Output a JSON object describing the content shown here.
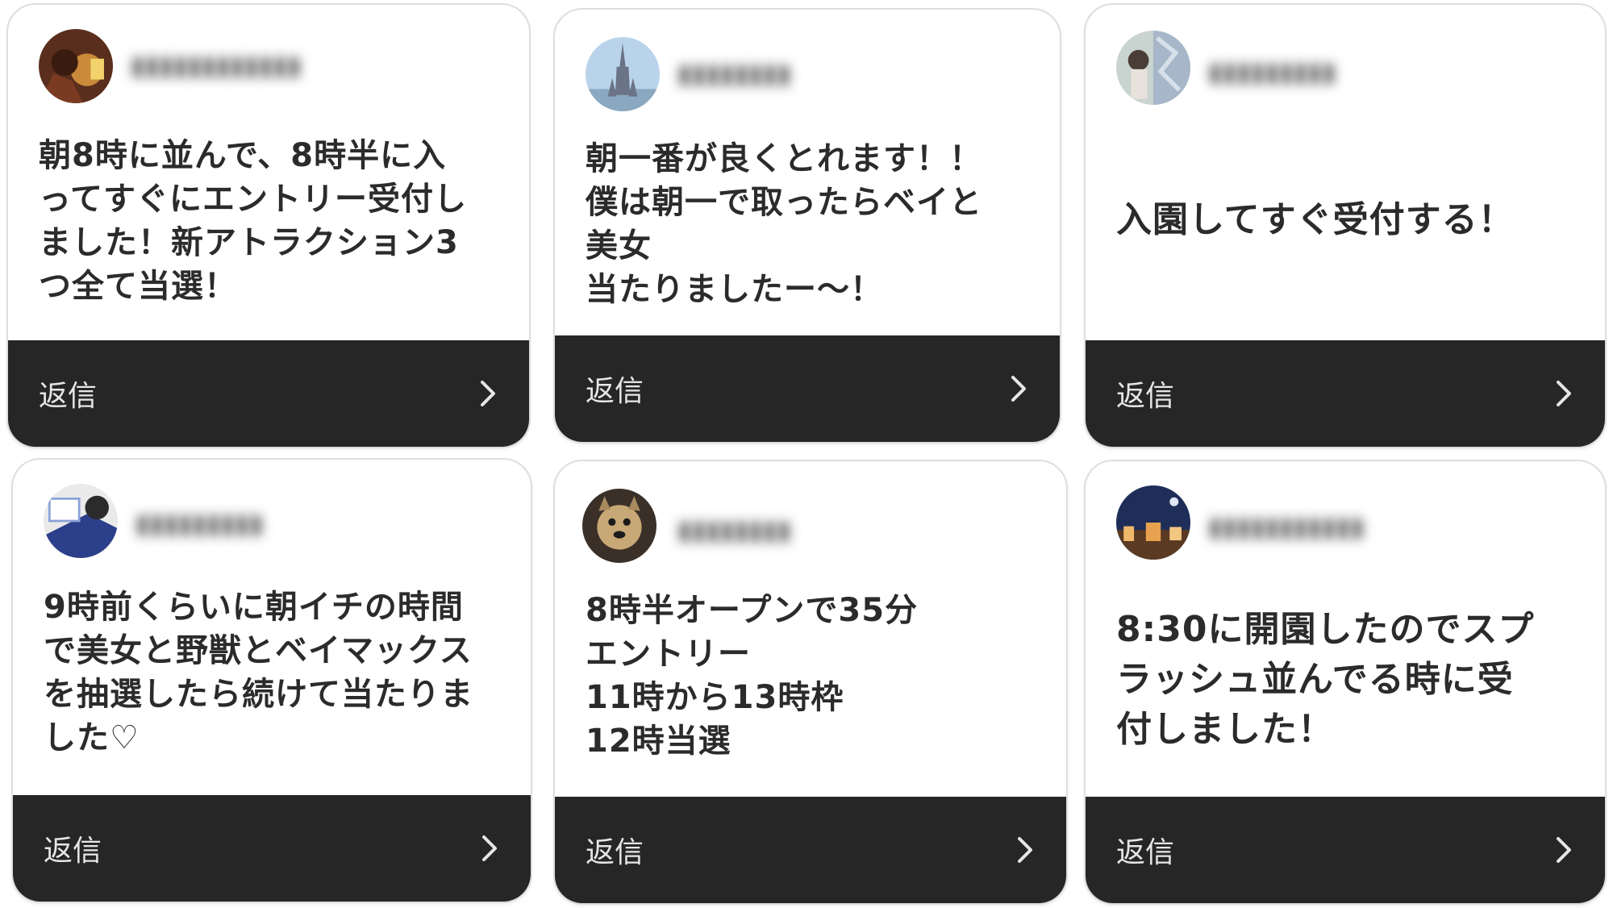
{
  "colors": {
    "card_background": "#ffffff",
    "reply_bar": "#262626",
    "reply_text": "#e6e6e6",
    "comment_text": "#2b2b2b"
  },
  "cards": [
    {
      "username": "▮▮▮▮▮▮▮▮▮▮▮▮",
      "comment": "朝8時に並んで、8時半に入\nってすぐにエントリー受付し\nました！新アトラクション3\nつ全て当選！",
      "reply_label": "返信",
      "avatar_icon": "user-avatar-icon",
      "reply_icon": "chevron-right-icon"
    },
    {
      "username": "▮▮▮▮▮▮▮▮",
      "comment": "朝一番が良くとれます！！\n僕は朝一で取ったらベイと\n美女\n当たりましたー〜！",
      "reply_label": "返信",
      "avatar_icon": "user-avatar-icon",
      "reply_icon": "chevron-right-icon"
    },
    {
      "username": "▮▮▮▮▮▮▮▮▮",
      "comment": "入園してすぐ受付する！",
      "reply_label": "返信",
      "avatar_icon": "user-avatar-icon",
      "reply_icon": "chevron-right-icon"
    },
    {
      "username": "▮▮▮▮▮▮▮▮▮",
      "comment": "9時前くらいに朝イチの時間\nで美女と野獣とベイマックス\nを抽選したら続けて当たりま\nした♡",
      "reply_label": "返信",
      "avatar_icon": "user-avatar-icon",
      "reply_icon": "chevron-right-icon"
    },
    {
      "username": "▮▮▮▮▮▮▮▮",
      "comment": "8時半オープンで35分\nエントリー\n11時から13時枠\n12時当選",
      "reply_label": "返信",
      "avatar_icon": "user-avatar-icon",
      "reply_icon": "chevron-right-icon"
    },
    {
      "username": "▮▮▮▮▮▮▮▮▮▮▮",
      "comment": "8:30に開園したのでスプ\nラッシュ並んでる時に受\n付しました！",
      "reply_label": "返信",
      "avatar_icon": "user-avatar-icon",
      "reply_icon": "chevron-right-icon"
    }
  ]
}
